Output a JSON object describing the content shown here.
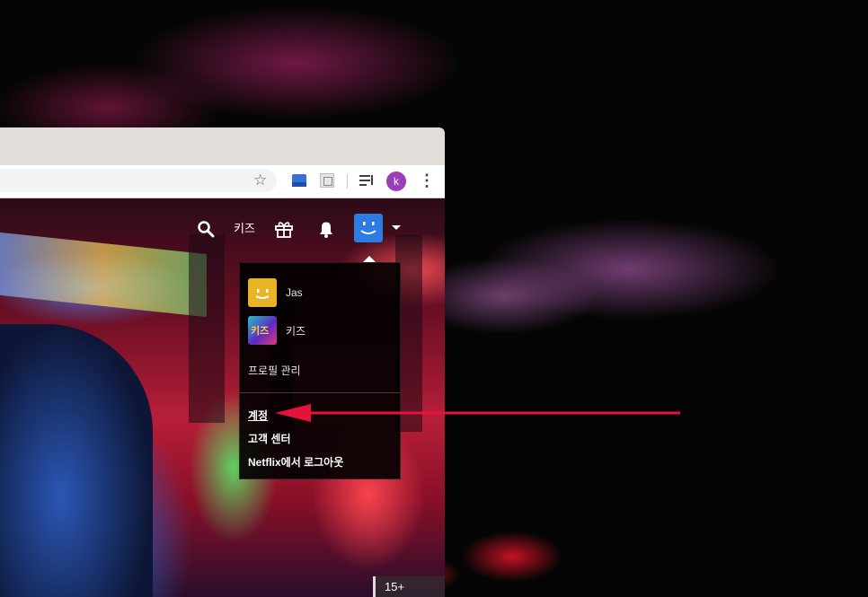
{
  "browser": {
    "toolbar": {
      "bookmark_icon": "star-icon",
      "extensions": [
        "extension-icon",
        "extension-icon"
      ],
      "media_icon": "queue-music-icon",
      "profile_initial": "k",
      "menu_icon": "more-vert-icon"
    }
  },
  "netflix": {
    "nav": {
      "search_icon": "search-icon",
      "kids_link": "키즈",
      "gift_icon": "gift-icon",
      "notifications_icon": "bell-icon",
      "profile_icon": "smiley-avatar-icon",
      "caret_icon": "caret-down-icon"
    },
    "profile_menu": {
      "profiles": [
        {
          "name": "Jas",
          "avatar_color": "#e8b426"
        },
        {
          "name": "키즈",
          "avatar_label": "키즈",
          "avatar_color": "#5b2ac2"
        }
      ],
      "manage_profiles": "프로필 관리",
      "links": [
        "계정",
        "고객 센터",
        "Netflix에서 로그아웃"
      ],
      "active_link": "계정"
    },
    "maturity_rating": "15+"
  },
  "colors": {
    "netflix_red": "#e50914",
    "annotation_arrow": "#e5133c",
    "profile_blue": "#2f7be4"
  }
}
